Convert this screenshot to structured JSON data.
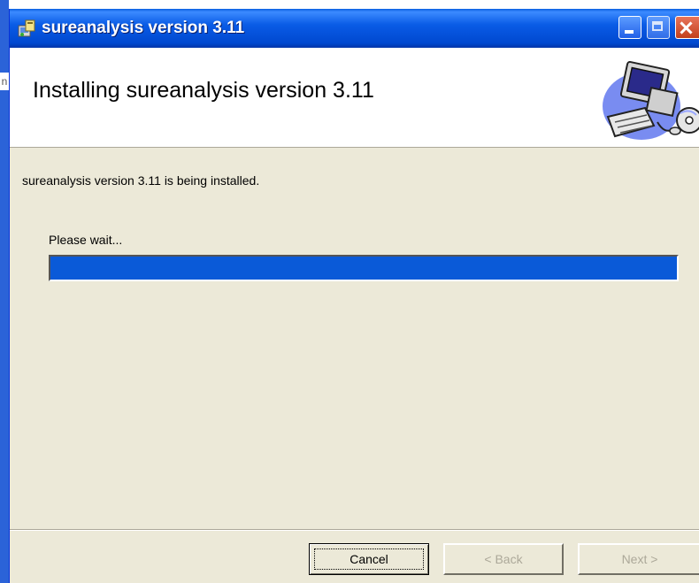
{
  "window": {
    "title": "sureanalysis version 3.11",
    "icons": {
      "app": "installer-icon",
      "minimize": "minimize-icon",
      "maximize": "maximize-icon",
      "close": "close-icon"
    }
  },
  "desktop": {
    "stub_text": "n"
  },
  "banner": {
    "heading": "Installing sureanalysis version 3.11",
    "icon": "computer-install-icon"
  },
  "body": {
    "status": "sureanalysis version 3.11 is being installed.",
    "wait_label": "Please wait...",
    "progress_fraction": 1.0
  },
  "buttons": {
    "cancel": "Cancel",
    "back": "< Back",
    "next": "Next >"
  },
  "colors": {
    "titlebar": "#0a5ce6",
    "progress_fill": "#0a5ad8",
    "dialog_bg": "#ece9d8"
  }
}
